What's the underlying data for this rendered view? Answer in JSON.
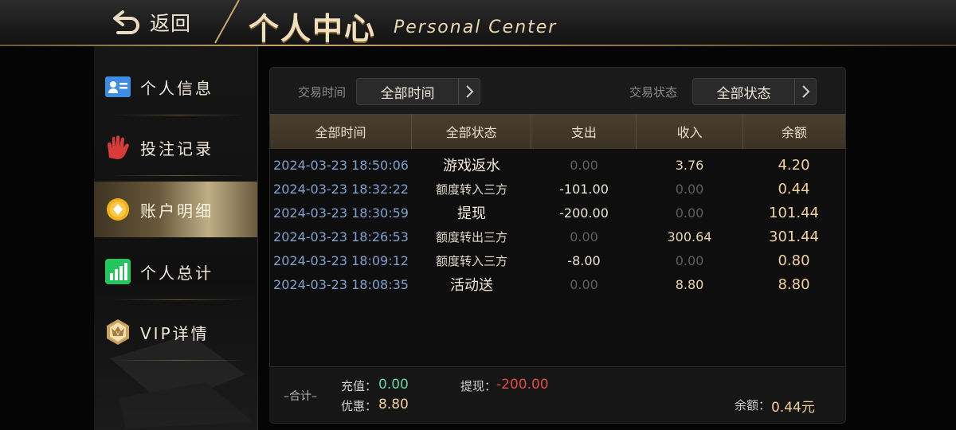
{
  "header": {
    "back_label": "返回",
    "title_cn": "个人中心",
    "title_en": "Personal Center"
  },
  "sidebar": {
    "items": [
      {
        "label": "个人信息",
        "icon": "id-card-icon"
      },
      {
        "label": "投注记录",
        "icon": "hand-icon"
      },
      {
        "label": "账户明细",
        "icon": "coin-icon",
        "active": true
      },
      {
        "label": "个人总计",
        "icon": "bar-chart-icon"
      },
      {
        "label": "VIP详情",
        "icon": "vip-crown-icon"
      }
    ]
  },
  "filters": {
    "time_label": "交易时间",
    "time_value": "全部时间",
    "status_label": "交易状态",
    "status_value": "全部状态"
  },
  "table": {
    "headers": [
      "全部时间",
      "全部状态",
      "支出",
      "收入",
      "余额"
    ],
    "rows": [
      {
        "time": "2024-03-23 18:50:06",
        "status": "游戏返水",
        "expense": "0.00",
        "income": "3.76",
        "balance": "4.20"
      },
      {
        "time": "2024-03-23 18:32:22",
        "status": "额度转入三方",
        "expense": "-101.00",
        "income": "0.00",
        "balance": "0.44"
      },
      {
        "time": "2024-03-23 18:30:59",
        "status": "提现",
        "expense": "-200.00",
        "income": "0.00",
        "balance": "101.44"
      },
      {
        "time": "2024-03-23 18:26:53",
        "status": "额度转出三方",
        "expense": "0.00",
        "income": "300.64",
        "balance": "301.44"
      },
      {
        "time": "2024-03-23 18:09:12",
        "status": "额度转入三方",
        "expense": "-8.00",
        "income": "0.00",
        "balance": "0.80"
      },
      {
        "time": "2024-03-23 18:08:35",
        "status": "活动送",
        "expense": "0.00",
        "income": "8.80",
        "balance": "8.80"
      }
    ]
  },
  "summary": {
    "title": "–合计–",
    "recharge_label": "充值：",
    "recharge_value": "0.00",
    "bonus_label": "优惠：",
    "bonus_value": "8.80",
    "withdraw_label": "提现：",
    "withdraw_value": "-200.00",
    "balance_label": "余额：",
    "balance_value": "0.44元"
  },
  "colors": {
    "accent_gold": "#c8a769",
    "date_blue": "#7fa3cf",
    "recharge_green": "#5fd6a4",
    "withdraw_red": "#e14a45",
    "balance_gold": "#f3cf99"
  }
}
